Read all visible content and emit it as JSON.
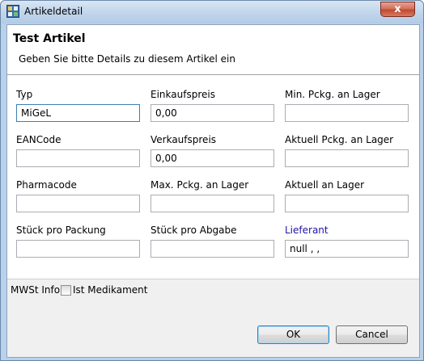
{
  "window": {
    "title": "Artikeldetail",
    "close_glyph": "x",
    "icon": "app-icon"
  },
  "header": {
    "title": "Test Artikel",
    "subtitle": "Geben Sie bitte Details zu diesem Artikel ein"
  },
  "fields": {
    "typ": {
      "label": "Typ",
      "value": "MiGeL"
    },
    "einkaufspreis": {
      "label": "Einkaufspreis",
      "value": "0,00"
    },
    "min_pckg": {
      "label": "Min. Pckg. an Lager",
      "value": ""
    },
    "eancode": {
      "label": "EANCode",
      "value": ""
    },
    "verkaufspreis": {
      "label": "Verkaufspreis",
      "value": "0,00"
    },
    "aktuell_pckg": {
      "label": "Aktuell Pckg. an Lager",
      "value": ""
    },
    "pharmacode": {
      "label": "Pharmacode",
      "value": ""
    },
    "max_pckg": {
      "label": "Max. Pckg. an Lager",
      "value": ""
    },
    "aktuell_lager": {
      "label": "Aktuell an Lager",
      "value": ""
    },
    "stueck_packung": {
      "label": "Stück pro Packung",
      "value": ""
    },
    "stueck_abgabe": {
      "label": "Stück pro Abgabe",
      "value": ""
    },
    "lieferant": {
      "label": "Lieferant",
      "value": "null , ,"
    }
  },
  "footer": {
    "mwst_label": "MWSt Info",
    "medikament_label": "Ist Medikament",
    "medikament_checked": false
  },
  "buttons": {
    "ok": "OK",
    "cancel": "Cancel"
  },
  "colors": {
    "link_label": "#1d12a8",
    "focus_border": "#3c7fb1",
    "close_button": "#c04a30"
  }
}
